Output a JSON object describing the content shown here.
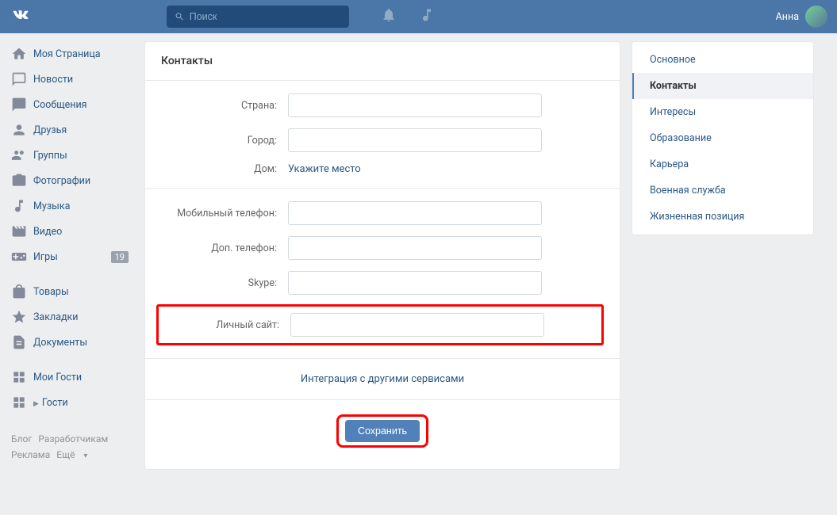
{
  "header": {
    "search_placeholder": "Поиск",
    "username": "Анна"
  },
  "left_nav": {
    "items": [
      {
        "label": "Моя Страница",
        "icon": "home"
      },
      {
        "label": "Новости",
        "icon": "news"
      },
      {
        "label": "Сообщения",
        "icon": "messages"
      },
      {
        "label": "Друзья",
        "icon": "friends"
      },
      {
        "label": "Группы",
        "icon": "groups"
      },
      {
        "label": "Фотографии",
        "icon": "photos"
      },
      {
        "label": "Музыка",
        "icon": "music"
      },
      {
        "label": "Видео",
        "icon": "video"
      },
      {
        "label": "Игры",
        "icon": "games",
        "badge": "19"
      }
    ],
    "items2": [
      {
        "label": "Товары",
        "icon": "market"
      },
      {
        "label": "Закладки",
        "icon": "bookmarks"
      },
      {
        "label": "Документы",
        "icon": "docs"
      }
    ],
    "items3": [
      {
        "label": "Мои Гости",
        "icon": "app"
      },
      {
        "label": "Гости",
        "icon": "app",
        "play": true
      }
    ]
  },
  "footer": {
    "l1": "Блог",
    "l2": "Разработчикам",
    "l3": "Реклама",
    "l4": "Ещё"
  },
  "main": {
    "title": "Контакты",
    "labels": {
      "country": "Страна:",
      "city": "Город:",
      "home": "Дом:",
      "home_link": "Укажите место",
      "mobile": "Мобильный телефон:",
      "alt_phone": "Доп. телефон:",
      "skype": "Skype:",
      "website": "Личный сайт:"
    },
    "integration_link": "Интеграция с другими сервисами",
    "save_button": "Сохранить"
  },
  "right_nav": {
    "items": [
      {
        "label": "Основное"
      },
      {
        "label": "Контакты",
        "active": true
      },
      {
        "label": "Интересы"
      },
      {
        "label": "Образование"
      },
      {
        "label": "Карьера"
      },
      {
        "label": "Военная служба"
      },
      {
        "label": "Жизненная позиция"
      }
    ]
  }
}
